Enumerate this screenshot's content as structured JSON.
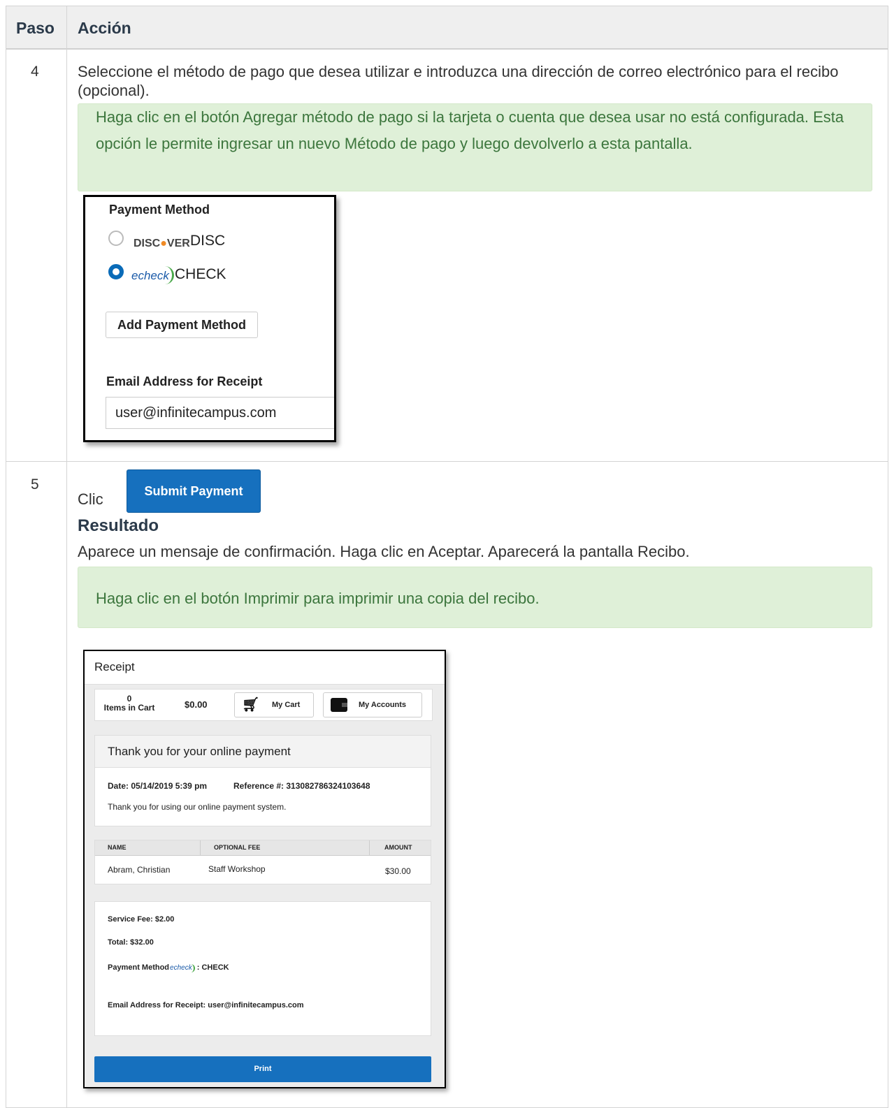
{
  "header": {
    "col_step": "Paso",
    "col_action": "Acción"
  },
  "step4": {
    "number": "4",
    "text": " Seleccione el método de pago que desea utilizar e introduzca una dirección de correo electrónico para el recibo (opcional).",
    "note": "Haga clic en el botón Agregar método de pago si la tarjeta o cuenta que desea usar no está configurada. Esta opción le permite ingresar un nuevo Método de pago y luego devolverlo a esta pantalla.",
    "screenshot": {
      "title": "Payment Method",
      "options": [
        {
          "logo": "DISCOVER",
          "label": "DISC",
          "selected": false
        },
        {
          "logo": "echeck",
          "label": "CHECK",
          "selected": true
        }
      ],
      "add_button": "Add Payment Method",
      "email_label": "Email Address for Receipt",
      "email_value": "user@infinitecampus.com"
    }
  },
  "step5": {
    "number": "5",
    "click_text": "Clic",
    "submit_button": "Submit Payment",
    "result_heading": "Resultado",
    "result_text": "Aparece un mensaje de confirmación. Haga clic en Aceptar. Aparecerá la pantalla Recibo.",
    "note": "Haga clic en el botón Imprimir para imprimir una copia del recibo.",
    "receipt": {
      "title": "Receipt",
      "cart_count": "0",
      "cart_count_label": "Items in Cart",
      "cart_total": "$0.00",
      "my_cart": "My Cart",
      "my_accounts": "My Accounts",
      "thanks_heading": "Thank you for your online payment",
      "date": "Date: 05/14/2019 5:39 pm",
      "reference": "Reference #: 313082786324103648",
      "thanks_text": "Thank you for using our online payment system.",
      "columns": [
        "NAME",
        "OPTIONAL FEE",
        "AMOUNT"
      ],
      "rows": [
        {
          "name": "Abram, Christian",
          "fee": "Staff Workshop",
          "amount": "$30.00"
        }
      ],
      "service_fee": "Service Fee: $2.00",
      "total": "Total: $32.00",
      "payment_method_label": "Payment Method",
      "payment_method_logo": "echeck",
      "payment_method_value": ": CHECK",
      "email_receipt": "Email Address for Receipt: user@infinitecampus.com",
      "print_button": "Print"
    }
  }
}
